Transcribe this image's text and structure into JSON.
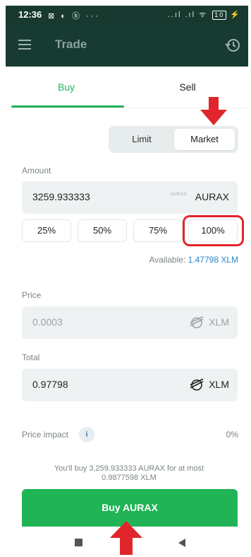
{
  "status": {
    "time": "12:36",
    "left_icons": "⊠ ◐ ⓑ ···",
    "right_icons": "..ıl .ıl ᯤ",
    "battery": "10"
  },
  "appbar": {
    "title": "Trade",
    "menu_icon": "hamburger-icon",
    "history_icon": "history-icon"
  },
  "tabs": {
    "buy": "Buy",
    "sell": "Sell"
  },
  "order_type": {
    "limit": "Limit",
    "market": "Market"
  },
  "amount": {
    "label": "Amount",
    "value": "3259.933333",
    "unit": "AURAX",
    "logo_text": "AURAX"
  },
  "percent_buttons": [
    "25%",
    "50%",
    "75%",
    "100%"
  ],
  "available": {
    "label": "Available:",
    "value": "1.47798 XLM"
  },
  "price": {
    "label": "Price",
    "value": "0.0003",
    "unit": "XLM"
  },
  "total": {
    "label": "Total",
    "value": "0.97798",
    "unit": "XLM"
  },
  "price_impact": {
    "label": "Price impact",
    "info": "i",
    "value": "0%"
  },
  "summary": {
    "line1": "You'll buy 3,259.933333 AURAX for at most",
    "line2": "0.9877598 XLM"
  },
  "buy_button": "Buy AURAX",
  "colors": {
    "accent": "#22b35b",
    "header": "#173b32",
    "annotation": "#e0262b",
    "link": "#2a86c9"
  }
}
